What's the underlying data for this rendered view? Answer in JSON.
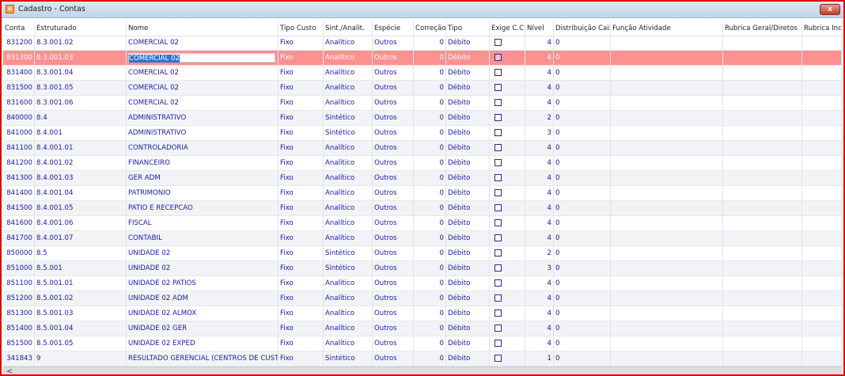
{
  "window": {
    "title": "Cadastro - Contas",
    "close_label": "x"
  },
  "columns": [
    "Conta",
    "Estruturado",
    "Nome",
    "Tipo Custo",
    "Sint./Analit.",
    "Espécie",
    "Correção",
    "Tipo",
    "Exige C.C.",
    "Nível",
    "Distribuição Caixa",
    "Função Atividade",
    "Rubrica Geral/Diretos",
    "Rubrica Indire"
  ],
  "selected_row": 1,
  "rows": [
    [
      "831200",
      "8.3.001.02",
      "COMERCIAL 02",
      "Fixo",
      "Analítico",
      "Outros",
      "0",
      "Débito",
      false,
      "4",
      "0"
    ],
    [
      "831300",
      "8.3.001.03",
      "COMERCIAL 02",
      "Fixo",
      "Analítico",
      "Outros",
      "0",
      "Débito",
      false,
      "4",
      "0"
    ],
    [
      "831400",
      "8.3.001.04",
      "COMERCIAL 02",
      "Fixo",
      "Analítico",
      "Outros",
      "0",
      "Débito",
      false,
      "4",
      "0"
    ],
    [
      "831500",
      "8.3.001.05",
      "COMERCIAL 02",
      "Fixo",
      "Analítico",
      "Outros",
      "0",
      "Débito",
      false,
      "4",
      "0"
    ],
    [
      "831600",
      "8.3.001.06",
      "COMERCIAL 02",
      "Fixo",
      "Analítico",
      "Outros",
      "0",
      "Débito",
      false,
      "4",
      "0"
    ],
    [
      "840000",
      "8.4",
      "ADMINISTRATIVO",
      "Fixo",
      "Sintético",
      "Outros",
      "0",
      "Débito",
      false,
      "2",
      "0"
    ],
    [
      "841000",
      "8.4.001",
      "ADMINISTRATIVO",
      "Fixo",
      "Sintético",
      "Outros",
      "0",
      "Débito",
      false,
      "3",
      "0"
    ],
    [
      "841100",
      "8.4.001.01",
      "CONTROLADORIA",
      "Fixo",
      "Analítico",
      "Outros",
      "0",
      "Débito",
      false,
      "4",
      "0"
    ],
    [
      "841200",
      "8.4.001.02",
      "FINANCEIRO",
      "Fixo",
      "Analítico",
      "Outros",
      "0",
      "Débito",
      false,
      "4",
      "0"
    ],
    [
      "841300",
      "8.4.001.03",
      "GER ADM",
      "Fixo",
      "Analítico",
      "Outros",
      "0",
      "Débito",
      false,
      "4",
      "0"
    ],
    [
      "841400",
      "8.4.001.04",
      "PATRIMONIO",
      "Fixo",
      "Analítico",
      "Outros",
      "0",
      "Débito",
      false,
      "4",
      "0"
    ],
    [
      "841500",
      "8.4.001.05",
      "PATIO E RECEPCAO",
      "Fixo",
      "Analítico",
      "Outros",
      "0",
      "Débito",
      false,
      "4",
      "0"
    ],
    [
      "841600",
      "8.4.001.06",
      "FISCAL",
      "Fixo",
      "Analítico",
      "Outros",
      "0",
      "Débito",
      false,
      "4",
      "0"
    ],
    [
      "841700",
      "8.4.001.07",
      "CONTABIL",
      "Fixo",
      "Analítico",
      "Outros",
      "0",
      "Débito",
      false,
      "4",
      "0"
    ],
    [
      "850000",
      "8.5",
      "UNIDADE 02",
      "Fixo",
      "Sintético",
      "Outros",
      "0",
      "Débito",
      false,
      "2",
      "0"
    ],
    [
      "851000",
      "8.5.001",
      "UNIDADE 02",
      "Fixo",
      "Sintético",
      "Outros",
      "0",
      "Débito",
      false,
      "3",
      "0"
    ],
    [
      "851100",
      "8.5.001.01",
      "UNIDADE 02 PATIOS",
      "Fixo",
      "Analítico",
      "Outros",
      "0",
      "Débito",
      false,
      "4",
      "0"
    ],
    [
      "851200",
      "8.5.001.02",
      "UNIDADE 02 ADM",
      "Fixo",
      "Analítico",
      "Outros",
      "0",
      "Débito",
      false,
      "4",
      "0"
    ],
    [
      "851300",
      "8.5.001.03",
      "UNIDADE 02 ALMOX",
      "Fixo",
      "Analítico",
      "Outros",
      "0",
      "Débito",
      false,
      "4",
      "0"
    ],
    [
      "851400",
      "8.5.001.04",
      "UNIDADE 02 GER",
      "Fixo",
      "Analítico",
      "Outros",
      "0",
      "Débito",
      false,
      "4",
      "0"
    ],
    [
      "851500",
      "8.5.001.05",
      "UNIDADE 02 EXPED",
      "Fixo",
      "Analítico",
      "Outros",
      "0",
      "Débito",
      false,
      "4",
      "0"
    ],
    [
      "341843",
      "9",
      "RESULTADO GERENCIAL (CENTROS DE CUSTO)",
      "Fixo",
      "Sintético",
      "Outros",
      "0",
      "Débito",
      false,
      "1",
      "0"
    ]
  ],
  "scrollbar": {
    "left_arrow": "<"
  }
}
